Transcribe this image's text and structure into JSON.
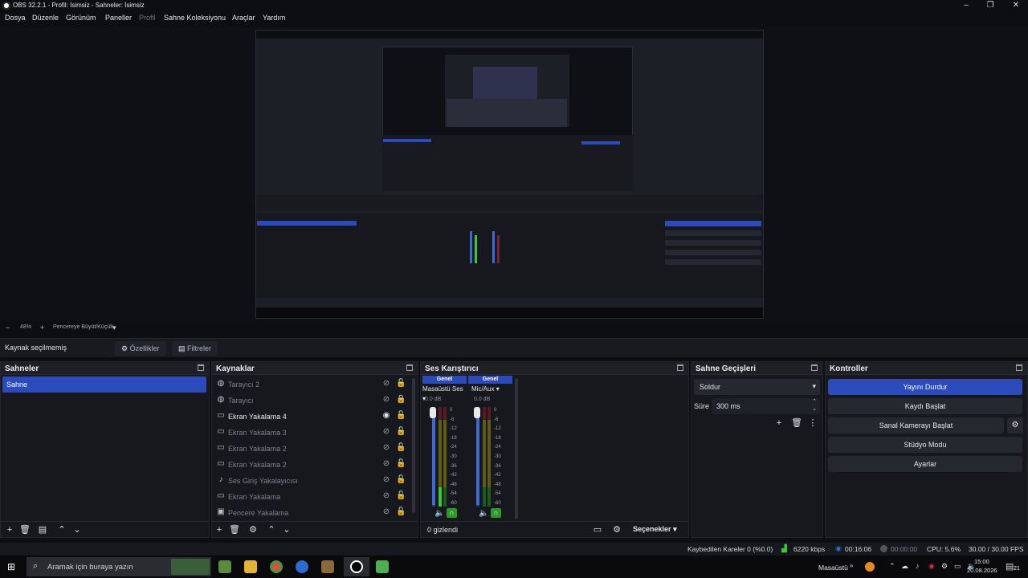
{
  "app": {
    "title": "OBS 32.2.1 - Profil: İsimsiz - Sahneler: İsimsiz"
  },
  "window_controls": {
    "minimize": "–",
    "maximize": "❐",
    "close": "✕"
  },
  "menu": [
    "Dosya",
    "Düzenle",
    "Görünüm",
    "Paneller",
    "Profil",
    "Sahne Koleksiyonu",
    "Araçlar",
    "Yardım"
  ],
  "zoom": {
    "minus": "−",
    "value": "48%",
    "plus": "+",
    "fit": "Pencereye Büyüt/Küçült",
    "dropdown": "▾"
  },
  "source_toolbar": {
    "no_source": "Kaynak seçilmemiş",
    "properties": "Özellikler",
    "filters": "Filtreler"
  },
  "scenes": {
    "title": "Sahneler",
    "items": [
      "Sahne"
    ]
  },
  "sources": {
    "title": "Kaynaklar",
    "items": [
      {
        "label": "Tarayıcı 2",
        "icon": "globe-icon",
        "visible": false
      },
      {
        "label": "Tarayıcı",
        "icon": "globe-icon",
        "visible": false
      },
      {
        "label": "Ekran Yakalama 4",
        "icon": "monitor-icon",
        "visible": true
      },
      {
        "label": "Ekran Yakalama 3",
        "icon": "monitor-icon",
        "visible": false
      },
      {
        "label": "Ekran Yakalama 2",
        "icon": "monitor-icon",
        "visible": false
      },
      {
        "label": "Ekran Yakalama 2",
        "icon": "monitor-icon",
        "visible": false
      },
      {
        "label": "Ses Giriş Yakalayıcısı",
        "icon": "mic-icon",
        "visible": false
      },
      {
        "label": "Ekran Yakalama",
        "icon": "monitor-icon",
        "visible": false
      },
      {
        "label": "Pencere Yakalama",
        "icon": "window-icon",
        "visible": false
      }
    ]
  },
  "mixer": {
    "title": "Ses Karıştırıcı",
    "channels": [
      {
        "header": "Genel",
        "name": "Masaüstü Ses",
        "db": "0.0 dB",
        "level": 0.15
      },
      {
        "header": "Genel",
        "name": "Mic/Aux",
        "db": "0.0 dB",
        "level": 0.0
      }
    ],
    "scale": [
      "0",
      "-6",
      "-12",
      "-18",
      "-24",
      "-30",
      "-36",
      "-42",
      "-48",
      "-54",
      "-60"
    ],
    "hidden": "0 gizlendi",
    "options": "Seçenekler"
  },
  "transitions": {
    "title": "Sahne Geçişleri",
    "selected": "Soldur",
    "duration_label": "Süre",
    "duration": "300 ms"
  },
  "controls": {
    "title": "Kontroller",
    "buttons": [
      "Yayını Durdur",
      "Kaydı Başlat",
      "Sanal Kamerayı Başlat",
      "Stüdyo Modu",
      "Ayarlar"
    ]
  },
  "status": {
    "dropped": "Kaybedilen Kareler 0 (%0.0)",
    "bitrate": "6220 kbps",
    "stream_time": "00:16:06",
    "rec_time": "00:00:00",
    "cpu": "CPU: 5.6%",
    "fps": "30.00 / 30.00 FPS"
  },
  "taskbar": {
    "search": "Aramak için buraya yazın",
    "desktop": "Masaüstü",
    "time": "15:00",
    "date": "20.08.2026",
    "notif": "21"
  },
  "colors": {
    "accent": "#2b4bbd",
    "bg": "#16181d",
    "live_green": "#3cc83c"
  }
}
